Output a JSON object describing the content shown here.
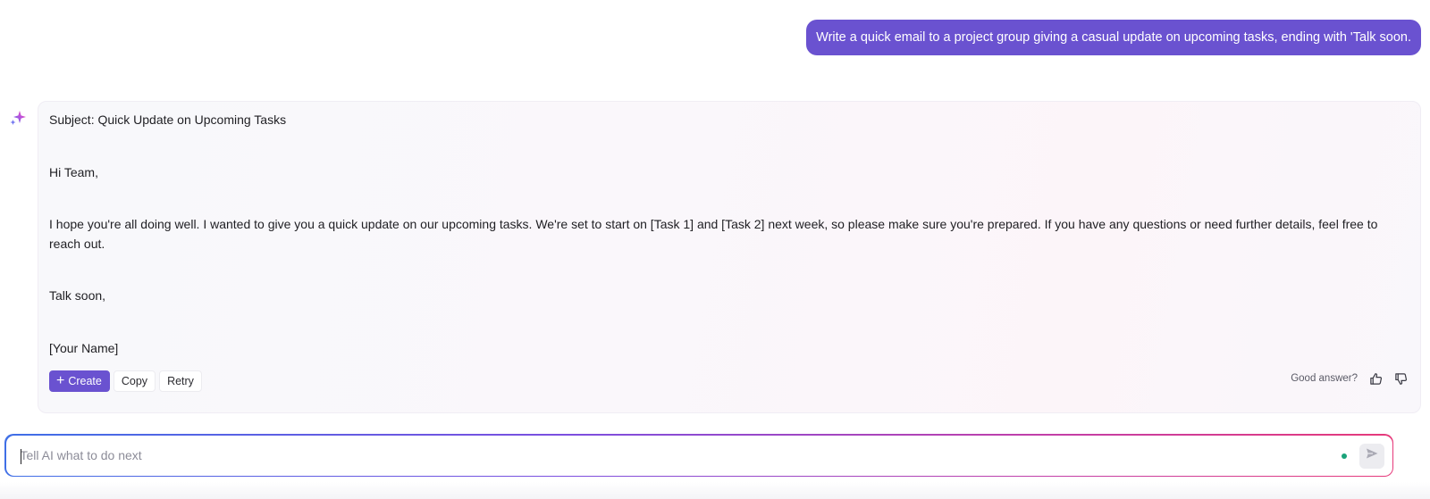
{
  "user_message": {
    "text": "Write a quick email to a project group giving a casual update on upcoming tasks, ending with 'Talk soon."
  },
  "assistant": {
    "avatar_icon": "sparkles-icon",
    "subject": "Subject: Quick Update on Upcoming Tasks",
    "greeting": "Hi Team,",
    "body": "I hope you're all doing well. I wanted to give you a quick update on our upcoming tasks. We're set to start on [Task 1] and [Task 2] next week, so please make sure you're prepared. If you have any questions or need further details, feel free to reach out.",
    "closing": "Talk soon,",
    "signature": "[Your Name]",
    "actions": {
      "create_label": "Create",
      "copy_label": "Copy",
      "retry_label": "Retry"
    },
    "feedback": {
      "prompt": "Good answer?",
      "thumbs_up_icon": "thumbs-up-icon",
      "thumbs_down_icon": "thumbs-down-icon"
    }
  },
  "composer": {
    "placeholder": "Tell AI what to do next",
    "value": "",
    "send_icon": "send-icon"
  },
  "colors": {
    "accent": "#6a52d0",
    "status_dot": "#1aa37a",
    "gradient_start": "#3f6fe6",
    "gradient_end": "#e6397a"
  }
}
